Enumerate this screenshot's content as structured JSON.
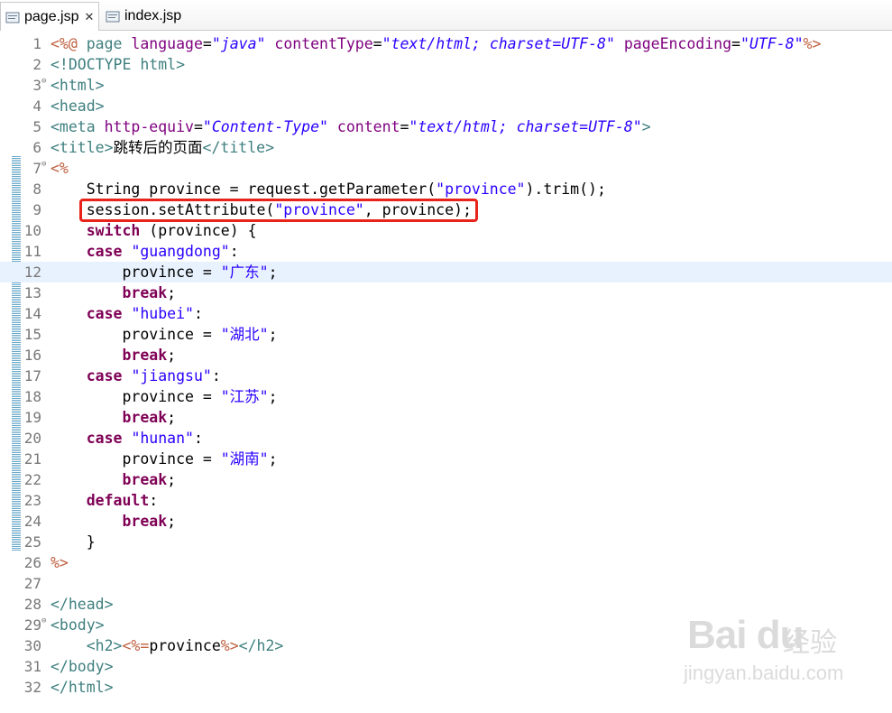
{
  "tabs": [
    {
      "label": "page.jsp",
      "icon": "jsp-file-icon",
      "active": true
    },
    {
      "label": "index.jsp",
      "icon": "jsp-file-icon",
      "active": false
    }
  ],
  "editor": {
    "lines": [
      {
        "n": "1",
        "parts": [
          [
            "jsp",
            "<%@ "
          ],
          [
            "tag",
            "page "
          ],
          [
            "attr",
            "language"
          ],
          [
            "",
            "="
          ],
          [
            "val",
            "\"java\""
          ],
          [
            "",
            " "
          ],
          [
            "attr",
            "contentType"
          ],
          [
            "",
            "="
          ],
          [
            "val",
            "\"text/html; charset=UTF-8\""
          ],
          [
            "",
            " "
          ],
          [
            "attr",
            "pageEncoding"
          ],
          [
            "",
            "="
          ],
          [
            "val",
            "\"UTF-8\""
          ],
          [
            "jsp",
            "%>"
          ]
        ]
      },
      {
        "n": "2",
        "parts": [
          [
            "tag",
            "<!DOCTYPE html>"
          ]
        ]
      },
      {
        "n": "3",
        "fold": true,
        "parts": [
          [
            "tag",
            "<html>"
          ]
        ]
      },
      {
        "n": "4",
        "parts": [
          [
            "tag",
            "<head>"
          ]
        ]
      },
      {
        "n": "5",
        "parts": [
          [
            "tag",
            "<meta "
          ],
          [
            "attr",
            "http-equiv"
          ],
          [
            "",
            "="
          ],
          [
            "val",
            "\"Content-Type\""
          ],
          [
            "",
            " "
          ],
          [
            "attr",
            "content"
          ],
          [
            "",
            "="
          ],
          [
            "val",
            "\"text/html; charset=UTF-8\""
          ],
          [
            "tag",
            ">"
          ]
        ]
      },
      {
        "n": "6",
        "parts": [
          [
            "tag",
            "<title>"
          ],
          [
            "",
            "跳转后的页面"
          ],
          [
            "tag",
            "</title>"
          ]
        ]
      },
      {
        "n": "7",
        "fold": true,
        "parts": [
          [
            "jsp",
            "<%"
          ]
        ]
      },
      {
        "n": "8",
        "parts": [
          [
            "",
            "    String province = request.getParameter("
          ],
          [
            "str",
            "\"province\""
          ],
          [
            "",
            ").trim();"
          ]
        ]
      },
      {
        "n": "9",
        "parts": [
          [
            "",
            "    session.setAttribute("
          ],
          [
            "str",
            "\"province\""
          ],
          [
            "",
            ", province);"
          ]
        ]
      },
      {
        "n": "10",
        "parts": [
          [
            "",
            "    "
          ],
          [
            "kw",
            "switch"
          ],
          [
            "",
            " (province) {"
          ]
        ]
      },
      {
        "n": "11",
        "parts": [
          [
            "",
            "    "
          ],
          [
            "kw",
            "case"
          ],
          [
            "",
            " "
          ],
          [
            "str",
            "\"guangdong\""
          ],
          [
            "",
            ":"
          ]
        ]
      },
      {
        "n": "12",
        "hl": true,
        "parts": [
          [
            "",
            "        province = "
          ],
          [
            "str",
            "\"广东\""
          ],
          [
            "",
            ";"
          ]
        ]
      },
      {
        "n": "13",
        "parts": [
          [
            "",
            "        "
          ],
          [
            "kw",
            "break"
          ],
          [
            "",
            ";"
          ]
        ]
      },
      {
        "n": "14",
        "parts": [
          [
            "",
            "    "
          ],
          [
            "kw",
            "case"
          ],
          [
            "",
            " "
          ],
          [
            "str",
            "\"hubei\""
          ],
          [
            "",
            ":"
          ]
        ]
      },
      {
        "n": "15",
        "parts": [
          [
            "",
            "        province = "
          ],
          [
            "str",
            "\"湖北\""
          ],
          [
            "",
            ";"
          ]
        ]
      },
      {
        "n": "16",
        "parts": [
          [
            "",
            "        "
          ],
          [
            "kw",
            "break"
          ],
          [
            "",
            ";"
          ]
        ]
      },
      {
        "n": "17",
        "parts": [
          [
            "",
            "    "
          ],
          [
            "kw",
            "case"
          ],
          [
            "",
            " "
          ],
          [
            "str",
            "\"jiangsu\""
          ],
          [
            "",
            ":"
          ]
        ]
      },
      {
        "n": "18",
        "parts": [
          [
            "",
            "        province = "
          ],
          [
            "str",
            "\"江苏\""
          ],
          [
            "",
            ";"
          ]
        ]
      },
      {
        "n": "19",
        "parts": [
          [
            "",
            "        "
          ],
          [
            "kw",
            "break"
          ],
          [
            "",
            ";"
          ]
        ]
      },
      {
        "n": "20",
        "parts": [
          [
            "",
            "    "
          ],
          [
            "kw",
            "case"
          ],
          [
            "",
            " "
          ],
          [
            "str",
            "\"hunan\""
          ],
          [
            "",
            ":"
          ]
        ]
      },
      {
        "n": "21",
        "parts": [
          [
            "",
            "        province = "
          ],
          [
            "str",
            "\"湖南\""
          ],
          [
            "",
            ";"
          ]
        ]
      },
      {
        "n": "22",
        "parts": [
          [
            "",
            "        "
          ],
          [
            "kw",
            "break"
          ],
          [
            "",
            ";"
          ]
        ]
      },
      {
        "n": "23",
        "parts": [
          [
            "",
            "    "
          ],
          [
            "kw",
            "default"
          ],
          [
            "",
            ":"
          ]
        ]
      },
      {
        "n": "24",
        "parts": [
          [
            "",
            "        "
          ],
          [
            "kw",
            "break"
          ],
          [
            "",
            ";"
          ]
        ]
      },
      {
        "n": "25",
        "parts": [
          [
            "",
            "    }"
          ]
        ]
      },
      {
        "n": "26",
        "parts": [
          [
            "jsp",
            "%>"
          ]
        ]
      },
      {
        "n": "27",
        "parts": []
      },
      {
        "n": "28",
        "parts": [
          [
            "tag",
            "</head>"
          ]
        ]
      },
      {
        "n": "29",
        "fold": true,
        "parts": [
          [
            "tag",
            "<body>"
          ]
        ]
      },
      {
        "n": "30",
        "parts": [
          [
            "",
            "    "
          ],
          [
            "tag",
            "<h2>"
          ],
          [
            "jsp",
            "<%="
          ],
          [
            "",
            "province"
          ],
          [
            "jsp",
            "%>"
          ],
          [
            "tag",
            "</h2>"
          ]
        ]
      },
      {
        "n": "31",
        "parts": [
          [
            "tag",
            "</body>"
          ]
        ]
      },
      {
        "n": "32",
        "parts": [
          [
            "tag",
            "</html>"
          ]
        ]
      }
    ]
  },
  "watermark": {
    "brand": "Bai du",
    "cn": "经验",
    "url": "jingyan.baidu.com"
  }
}
